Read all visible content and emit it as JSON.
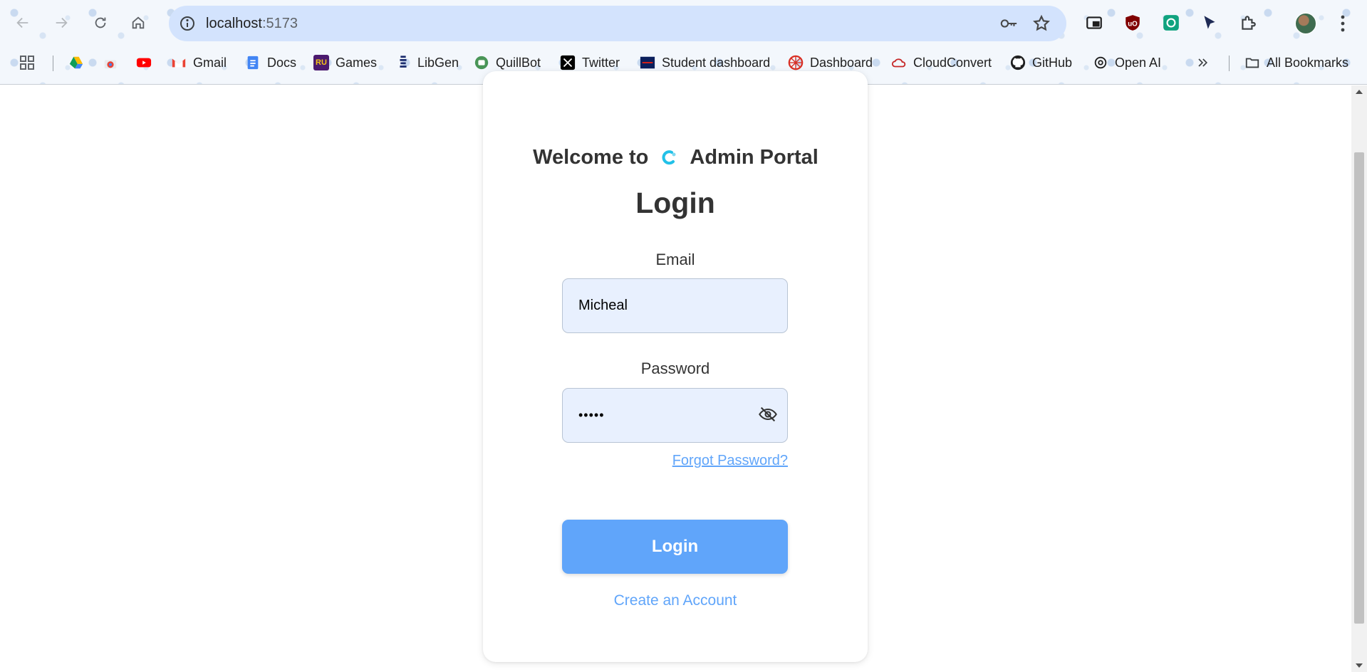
{
  "browser": {
    "url_host": "localhost",
    "url_port": ":5173",
    "bookmarks": [
      {
        "label": "",
        "icon": "google-drive-icon"
      },
      {
        "label": "",
        "icon": "chrome-web-store-icon"
      },
      {
        "label": "",
        "icon": "youtube-icon"
      },
      {
        "label": "Gmail",
        "icon": "gmail-icon"
      },
      {
        "label": "Docs",
        "icon": "docs-icon"
      },
      {
        "label": "Games",
        "icon": "games-icon"
      },
      {
        "label": "LibGen",
        "icon": "libgen-icon"
      },
      {
        "label": "QuillBot",
        "icon": "quillbot-icon"
      },
      {
        "label": "Twitter",
        "icon": "x-icon"
      },
      {
        "label": "Student dashboard",
        "icon": "student-dashboard-icon"
      },
      {
        "label": "Dashboard",
        "icon": "dashboard-icon"
      },
      {
        "label": "CloudConvert",
        "icon": "cloudconvert-icon"
      },
      {
        "label": "GitHub",
        "icon": "github-icon"
      },
      {
        "label": "Open AI",
        "icon": "openai-icon"
      }
    ],
    "all_bookmarks_label": "All Bookmarks"
  },
  "login": {
    "welcome_prefix": "Welcome to",
    "welcome_suffix": "Admin Portal",
    "title": "Login",
    "email_label": "Email",
    "email_value": "Micheal",
    "password_label": "Password",
    "password_value": "•••••",
    "forgot_link": "Forgot Password?",
    "login_button": "Login",
    "create_account": "Create an Account"
  },
  "colors": {
    "accent": "#60a5fa",
    "input_bg": "#e8f0fe",
    "omnibox_bg": "#d3e3fd"
  }
}
